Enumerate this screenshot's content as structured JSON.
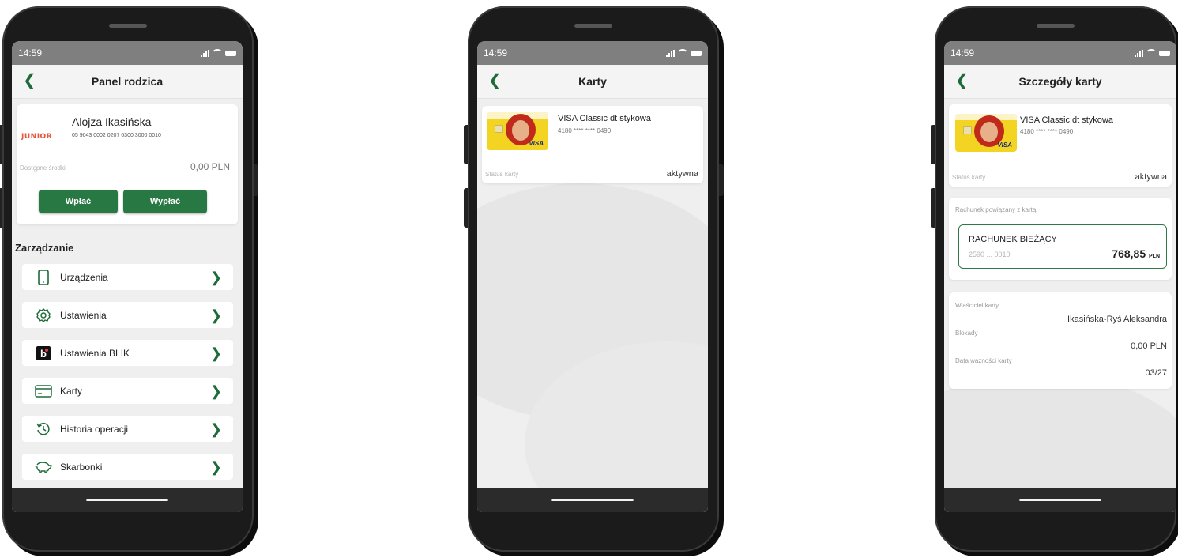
{
  "status_time": "14:59",
  "colors": {
    "accent": "#277842",
    "chevron": "#1e6b3a",
    "screen_bg": "#efefef"
  },
  "screen1": {
    "title": "Panel rodzica",
    "child_name": "Alojza Ikasińska",
    "junior_logo": "JUNIOR",
    "account_number": "05 9043 0002 0207 6300 3000 0010",
    "available_label": "Dostępne środki",
    "available_value": "0,00 PLN",
    "deposit_button": "Wpłać",
    "withdraw_button": "Wypłać",
    "section_title": "Zarządzanie",
    "menu": [
      {
        "label": "Urządzenia",
        "icon": "phone-icon"
      },
      {
        "label": "Ustawienia",
        "icon": "gear-icon"
      },
      {
        "label": "Ustawienia BLIK",
        "icon": "blik-icon"
      },
      {
        "label": "Karty",
        "icon": "card-icon"
      },
      {
        "label": "Historia operacji",
        "icon": "history-icon"
      },
      {
        "label": "Skarbonki",
        "icon": "piggy-bank-icon"
      }
    ]
  },
  "screen2": {
    "title": "Karty",
    "card_name": "VISA Classic dt stykowa",
    "card_number": "4180 **** **** 0490",
    "status_label": "Status karty",
    "status_value": "aktywna"
  },
  "screen3": {
    "title": "Szczegóły karty",
    "card_name": "VISA Classic dt stykowa",
    "card_number": "4180 **** **** 0490",
    "status_label": "Status karty",
    "status_value": "aktywna",
    "linked_label": "Rachunek powiązany z kartą",
    "account_name": "RACHUNEK BIEŻĄCY",
    "account_short": "2590 ... 0010",
    "balance_main": "768,85",
    "balance_currency": "PLN",
    "owner_label": "Właściciel karty",
    "owner_value": "Ikasińska-Ryś Aleksandra",
    "blocks_label": "Blokady",
    "blocks_value": "0,00 PLN",
    "expiry_label": "Data ważności karty",
    "expiry_value": "03/27"
  }
}
